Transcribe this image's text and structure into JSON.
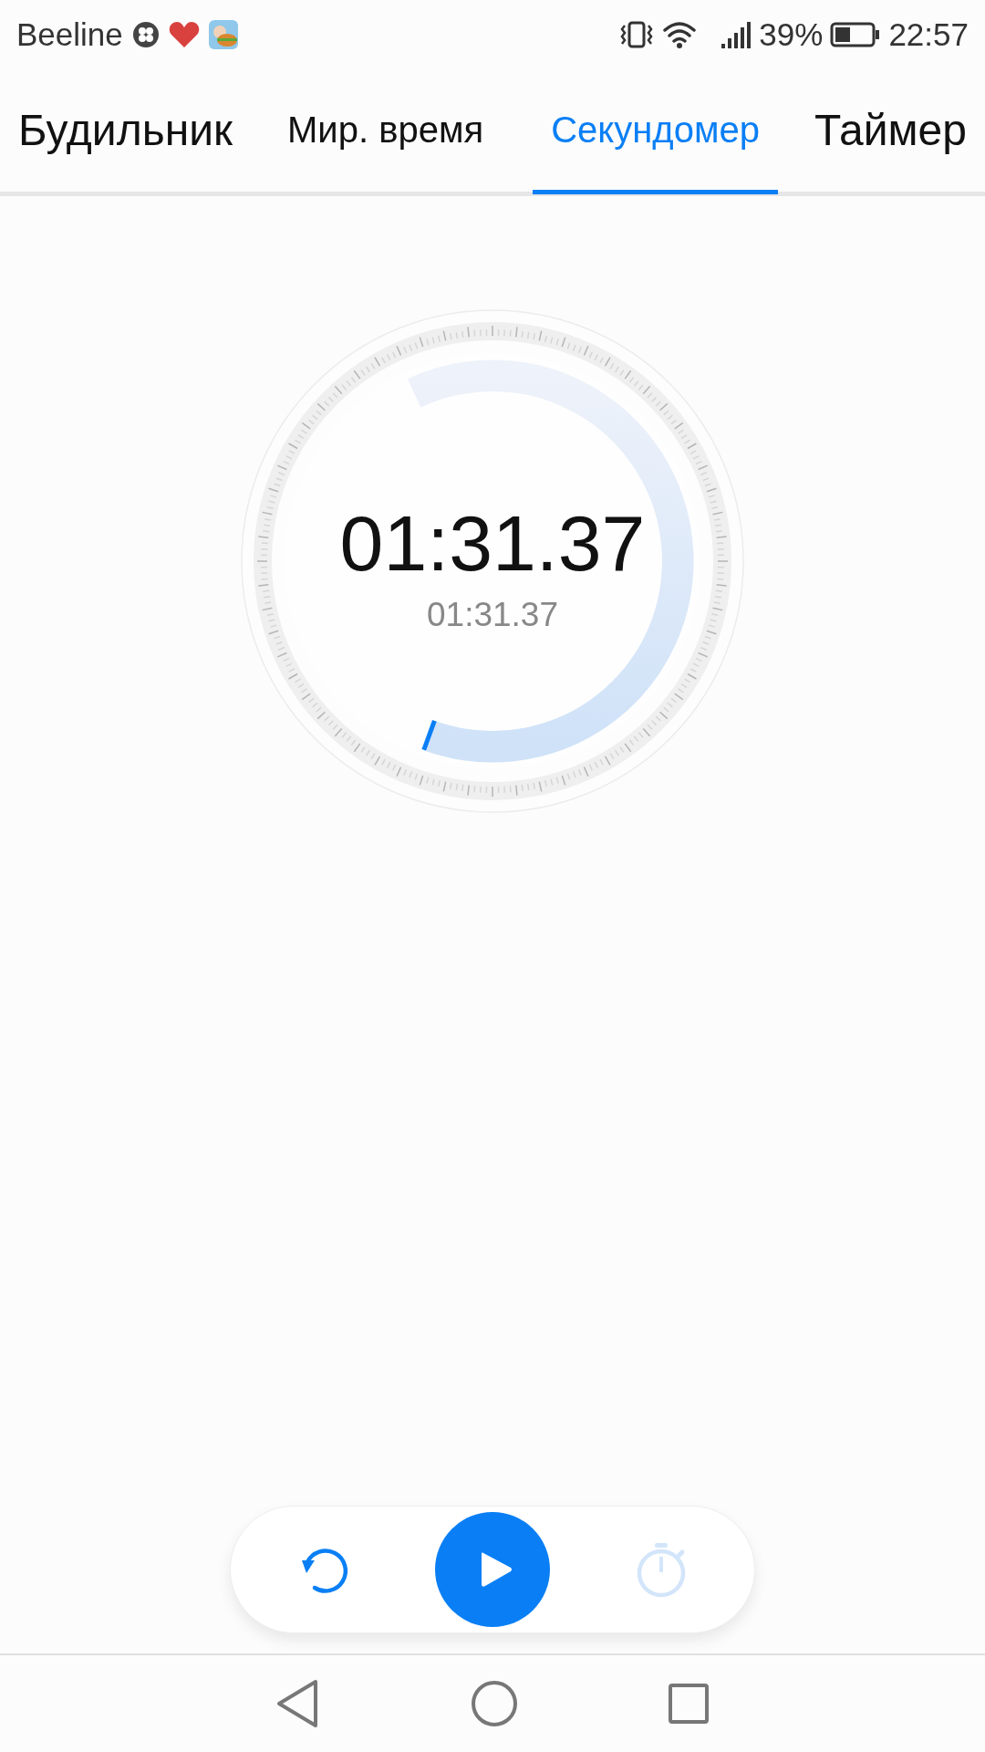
{
  "status_bar": {
    "carrier": "Beeline",
    "battery_percent": "39%",
    "time": "22:57"
  },
  "tabs": [
    {
      "label": "Будильник",
      "selected": false
    },
    {
      "label": "Мир. время",
      "selected": false
    },
    {
      "label": "Секундомер",
      "selected": true
    },
    {
      "label": "Таймер",
      "selected": false
    }
  ],
  "stopwatch": {
    "time": "01:31.37",
    "lap_time": "01:31.37"
  },
  "controls": [
    {
      "kind": "reset",
      "disabled": false
    },
    {
      "kind": "play",
      "disabled": false
    },
    {
      "kind": "lap",
      "disabled": true
    }
  ]
}
